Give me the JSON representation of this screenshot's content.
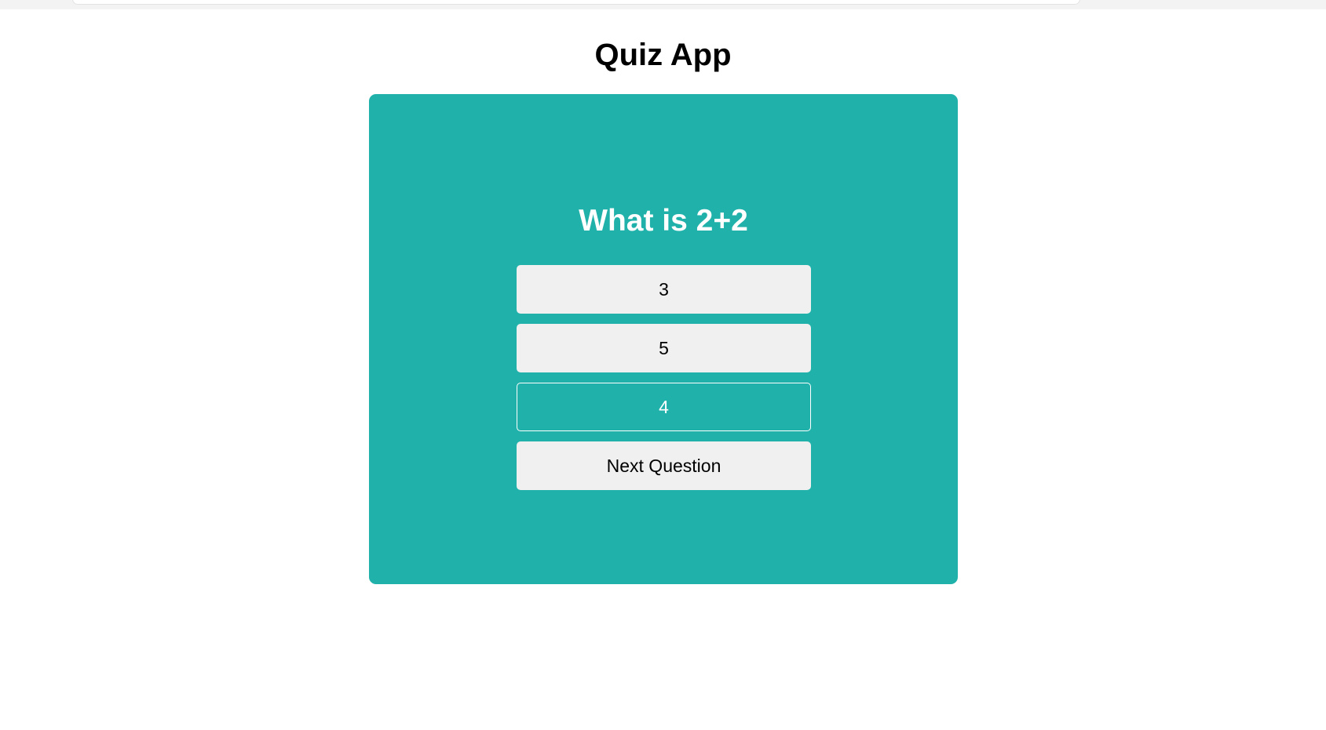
{
  "app": {
    "title": "Quiz App"
  },
  "quiz": {
    "question": "What is 2+2",
    "answers": [
      {
        "label": "3",
        "state": "default"
      },
      {
        "label": "5",
        "state": "default"
      },
      {
        "label": "4",
        "state": "selected"
      }
    ],
    "next_label": "Next Question"
  },
  "colors": {
    "card_background": "#20b2aa",
    "button_background": "#f0f0f0",
    "selected_border": "#ffffff",
    "title_text": "#000000",
    "question_text": "#ffffff"
  }
}
